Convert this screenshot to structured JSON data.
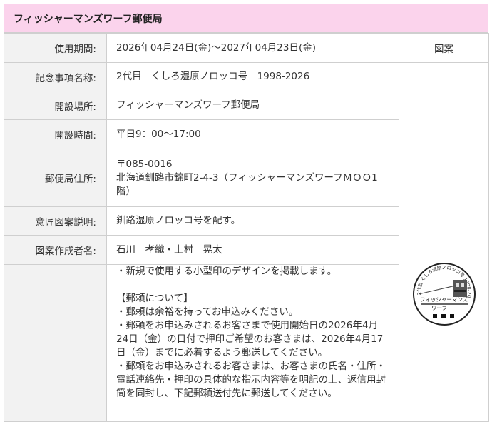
{
  "title": "フィッシャーマンズワーフ郵便局",
  "rows": {
    "period": {
      "label": "使用期間:",
      "value": "2026年04月24日(金)～2027年04月23日(金)"
    },
    "event": {
      "label": "記念事項名称:",
      "value": "2代目　くしろ湿原ノロッコ号　1998-2026"
    },
    "place": {
      "label": "開設場所:",
      "value": "フィッシャーマンズワーフ郵便局"
    },
    "hours": {
      "label": "開設時間:",
      "value": "平日9：00～17:00"
    },
    "address": {
      "label": "郵便局住所:",
      "zip": "〒085-0016",
      "line": "北海道釧路市錦町2-4-3（フィッシャーマンズワーフＭＯＯ1階）"
    },
    "design": {
      "label": "意匠図案説明:",
      "value": "釧路湿原ノロッコ号を配す。"
    },
    "author": {
      "label": "図案作成者名:",
      "value": "石川　孝織・上村　晃太"
    }
  },
  "figure_header": "図案",
  "notes": {
    "line1": "・新規で使用する小型印のデザインを掲載します。",
    "heading": "【郵頼について】",
    "b1": "・郵頼は余裕を持ってお申込みください。",
    "b2": "・郵頼をお申込みされるお客さまで使用開始日の2026年4月24日（金）の日付で押印ご希望のお客さまは、2026年4月17日（金）までに必着するよう郵送してください。",
    "b3": "・郵頼をお申込みされるお客さまは、お客さまの氏名・住所・電話連絡先・押印の具体的な指示内容等を明記の上、返信用封筒を同封し、下記郵頼送付先に郵送してください。"
  },
  "stamp": {
    "arc_text": "2代目 くしろ湿原ノロッコ号 1998-2026",
    "main_text": "フィッシャーマンズ",
    "sub_text": "ワーフ"
  }
}
